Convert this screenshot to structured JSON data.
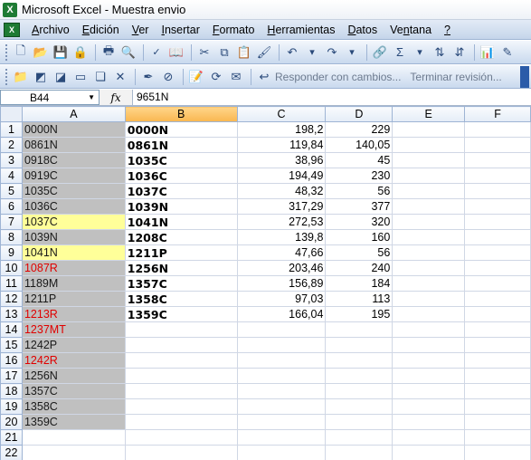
{
  "window": {
    "title": "Microsoft Excel - Muestra envio",
    "app_icon": "excel-icon"
  },
  "menu": [
    {
      "label": "Archivo",
      "ul": "A"
    },
    {
      "label": "Edición",
      "ul": "E"
    },
    {
      "label": "Ver",
      "ul": "V"
    },
    {
      "label": "Insertar",
      "ul": "I"
    },
    {
      "label": "Formato",
      "ul": "F"
    },
    {
      "label": "Herramientas",
      "ul": "H"
    },
    {
      "label": "Datos",
      "ul": "D"
    },
    {
      "label": "Ventana",
      "ul": "n"
    },
    {
      "label": "?",
      "ul": "?"
    }
  ],
  "toolbar2": {
    "reply_changes": "Responder con cambios...",
    "end_review": "Terminar revisión..."
  },
  "formula_bar": {
    "name_box": "B44",
    "fx_label": "fx",
    "content": "9651N"
  },
  "columns": [
    "A",
    "B",
    "C",
    "D",
    "E",
    "F"
  ],
  "rows": [
    {
      "n": "1",
      "a": "0000N",
      "b": "0000N",
      "c": "198,2",
      "d": "229"
    },
    {
      "n": "2",
      "a": "0861N",
      "b": "0861N",
      "c": "119,84",
      "d": "140,05"
    },
    {
      "n": "3",
      "a": "0918C",
      "b": "1035C",
      "c": "38,96",
      "d": "45"
    },
    {
      "n": "4",
      "a": "0919C",
      "b": "1036C",
      "c": "194,49",
      "d": "230"
    },
    {
      "n": "5",
      "a": "1035C",
      "b": "1037C",
      "c": "48,32",
      "d": "56"
    },
    {
      "n": "6",
      "a": "1036C",
      "b": "1039N",
      "c": "317,29",
      "d": "377"
    },
    {
      "n": "7",
      "a": "1037C",
      "b": "1041N",
      "c": "272,53",
      "d": "320",
      "style": "hl"
    },
    {
      "n": "8",
      "a": "1039N",
      "b": "1208C",
      "c": "139,8",
      "d": "160"
    },
    {
      "n": "9",
      "a": "1041N",
      "b": "1211P",
      "c": "47,66",
      "d": "56",
      "style": "hl"
    },
    {
      "n": "10",
      "a": "1087R",
      "b": "1256N",
      "c": "203,46",
      "d": "240",
      "style": "red"
    },
    {
      "n": "11",
      "a": "1189M",
      "b": "1357C",
      "c": "156,89",
      "d": "184"
    },
    {
      "n": "12",
      "a": "1211P",
      "b": "1358C",
      "c": "97,03",
      "d": "113"
    },
    {
      "n": "13",
      "a": "1213R",
      "b": "1359C",
      "c": "166,04",
      "d": "195",
      "style": "red"
    },
    {
      "n": "14",
      "a": "1237MT",
      "b": "",
      "c": "",
      "d": "",
      "style": "red"
    },
    {
      "n": "15",
      "a": "1242P",
      "b": "",
      "c": "",
      "d": ""
    },
    {
      "n": "16",
      "a": "1242R",
      "b": "",
      "c": "",
      "d": "",
      "style": "red"
    },
    {
      "n": "17",
      "a": "1256N",
      "b": "",
      "c": "",
      "d": ""
    },
    {
      "n": "18",
      "a": "1357C",
      "b": "",
      "c": "",
      "d": ""
    },
    {
      "n": "19",
      "a": "1358C",
      "b": "",
      "c": "",
      "d": ""
    },
    {
      "n": "20",
      "a": "1359C",
      "b": "",
      "c": "",
      "d": ""
    },
    {
      "n": "21",
      "a": "",
      "b": "",
      "c": "",
      "d": "",
      "nocolor": true
    },
    {
      "n": "22",
      "a": "",
      "b": "",
      "c": "",
      "d": "",
      "nocolor": true
    }
  ],
  "colors": {
    "highlight": "#ffff99",
    "gray_fill": "#c0c0c0",
    "red_text": "#e00000",
    "selected_header": "#f9b750"
  }
}
